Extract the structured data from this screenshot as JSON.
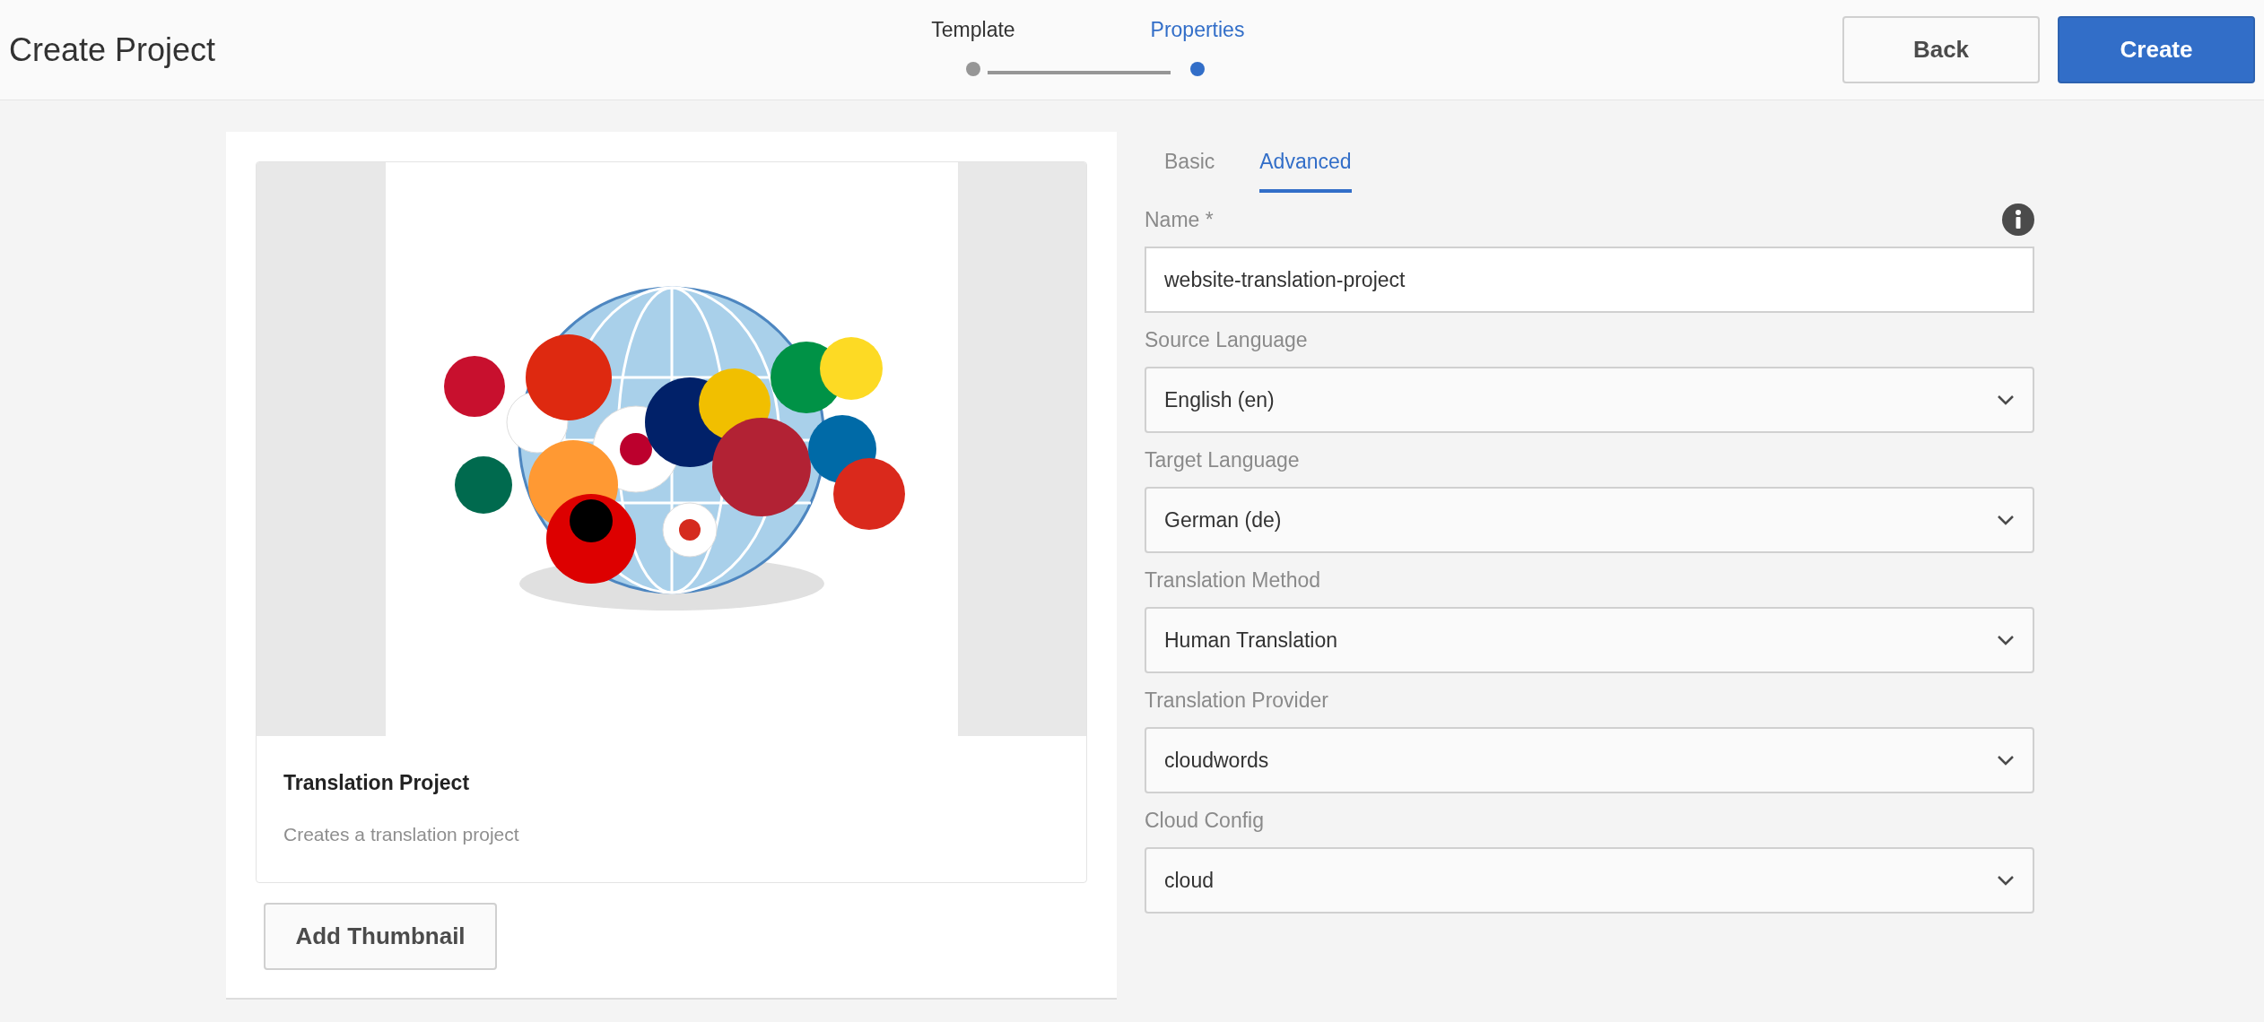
{
  "header": {
    "title": "Create Project",
    "steps": [
      {
        "label": "Template",
        "selected": false
      },
      {
        "label": "Properties",
        "selected": true
      }
    ],
    "buttons": [
      {
        "label": "Back",
        "kind": "secondary"
      },
      {
        "label": "Create",
        "kind": "primary"
      }
    ]
  },
  "template_card": {
    "title": "Translation Project",
    "description": "Creates a translation project",
    "button": "Add Thumbnail"
  },
  "tabs": [
    {
      "label": "Basic",
      "selected": false
    },
    {
      "label": "Advanced",
      "selected": true
    }
  ],
  "fields": [
    {
      "label": "Name *",
      "kind": "text",
      "value": "website-translation-project",
      "info": true
    },
    {
      "label": "Source Language",
      "kind": "select",
      "value": "English (en)"
    },
    {
      "label": "Target Language",
      "kind": "select",
      "value": "German (de)"
    },
    {
      "label": "Translation Method",
      "kind": "select",
      "value": "Human Translation"
    },
    {
      "label": "Translation Provider",
      "kind": "select",
      "value": "cloudwords"
    },
    {
      "label": "Cloud Config",
      "kind": "select",
      "value": "cloud"
    }
  ]
}
